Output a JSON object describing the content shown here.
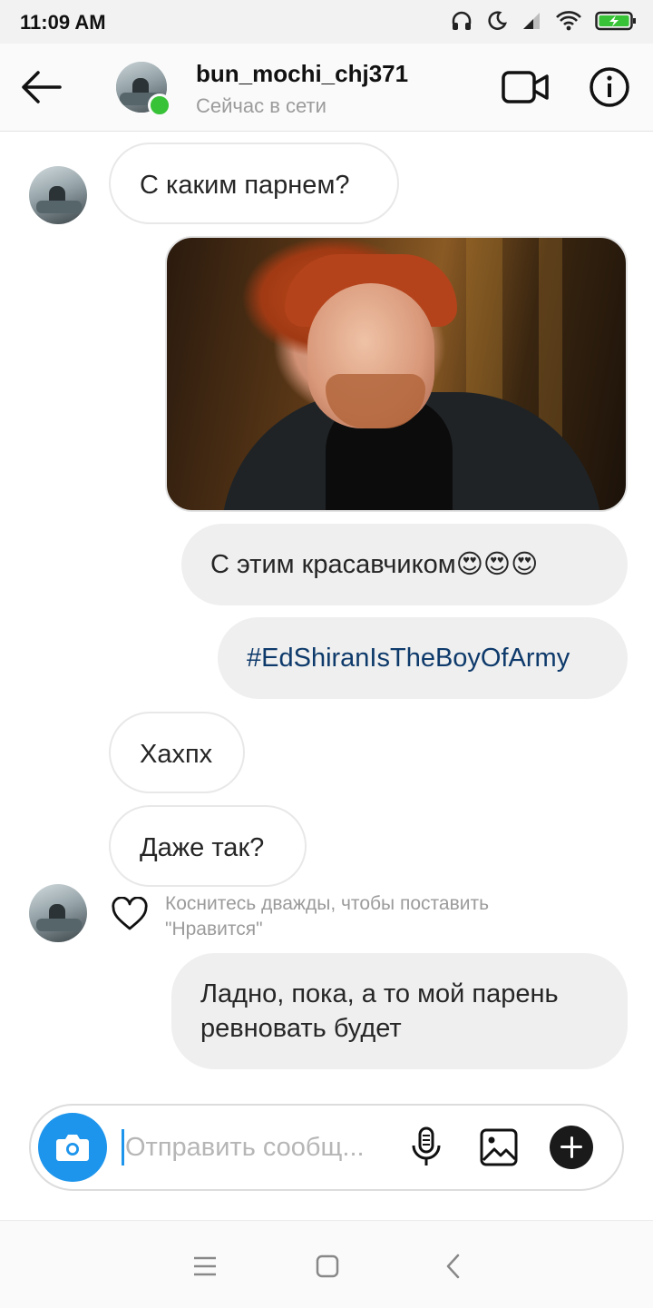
{
  "status_bar": {
    "time": "11:09 AM",
    "icons": [
      "headphones-icon",
      "moon-icon",
      "signal-icon",
      "wifi-icon",
      "battery-charging-icon"
    ],
    "battery_color": "#37c237"
  },
  "header": {
    "username": "bun_mochi_chj371",
    "presence": "Сейчас в сети",
    "online_color": "#37c237"
  },
  "messages": [
    {
      "side": "in",
      "text": "С каким парнем?"
    },
    {
      "side": "out",
      "type": "image",
      "alt": "photo"
    },
    {
      "side": "out",
      "text": "С этим красавчиком😍😍😍"
    },
    {
      "side": "out",
      "text": "#EdShiranIsTheBoyOfArmy"
    },
    {
      "side": "in",
      "text": "Хахпх"
    },
    {
      "side": "in",
      "text": "Даже так?"
    },
    {
      "side": "out",
      "text": "Ладно, пока, а то мой парень ревновать будет"
    }
  ],
  "like_hint": "Коснитесь дважды, чтобы поставить \"Нравится\"",
  "composer": {
    "placeholder": "Отправить сообщ...",
    "value": "",
    "accent": "#1d95ec"
  },
  "nav": {
    "buttons": [
      "menu-icon",
      "home-square-icon",
      "back-chevron-icon"
    ]
  }
}
